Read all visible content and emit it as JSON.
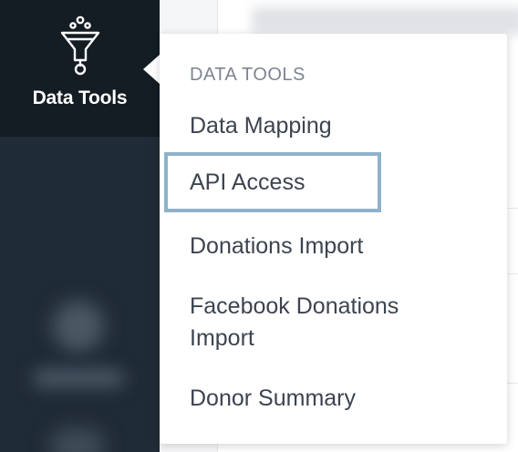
{
  "sidebar": {
    "active_item": {
      "label": "Data Tools",
      "icon": "funnel-icon"
    }
  },
  "menu": {
    "header": "DATA TOOLS",
    "items": [
      {
        "label": "Data Mapping"
      },
      {
        "label": "API Access",
        "highlighted": true
      },
      {
        "label": "Donations Import"
      },
      {
        "label": "Facebook Donations Import"
      },
      {
        "label": "Donor Summary"
      }
    ]
  },
  "colors": {
    "sidebar_bg": "#1f2b36",
    "sidebar_active_bg": "#141c24",
    "highlight_border": "#8eb2c9",
    "menu_text": "#3c4450",
    "menu_header_text": "#7d8590"
  }
}
